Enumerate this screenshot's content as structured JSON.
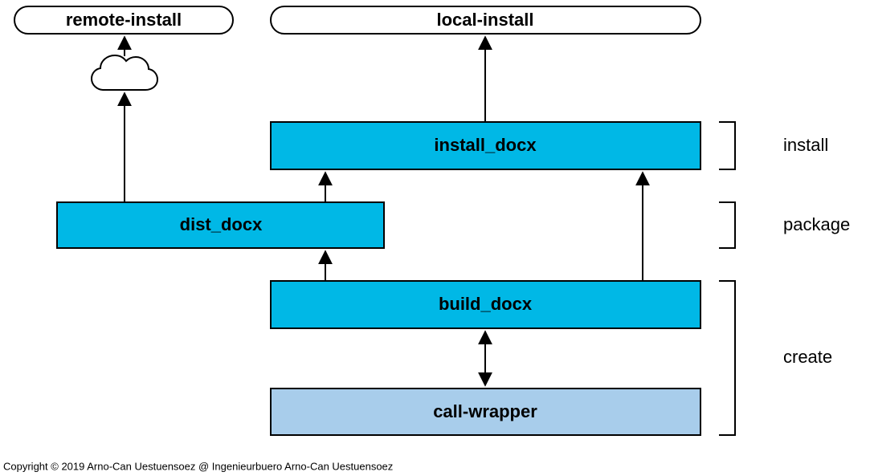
{
  "nodes": {
    "remote_install": "remote-install",
    "local_install": "local-install",
    "install_docx": "install_docx",
    "dist_docx": "dist_docx",
    "build_docx": "build_docx",
    "call_wrapper": "call-wrapper"
  },
  "phases": {
    "install": "install",
    "package": "package",
    "create": "create"
  },
  "copyright": "Copyright © 2019 Arno-Can Uestuensoez @ Ingenieurbuero Arno-Can Uestuensoez"
}
